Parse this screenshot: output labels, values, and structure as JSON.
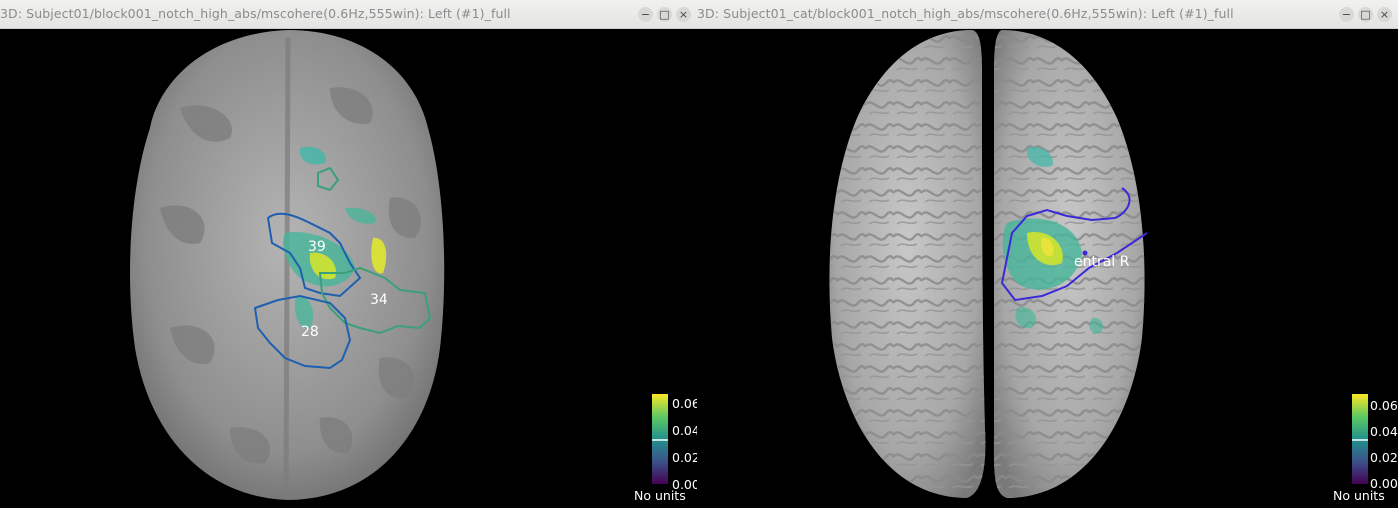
{
  "left_window": {
    "title": "3D: Subject01/block001_notch_high_abs/mscohere(0.6Hz,555win): Left (#1)_full",
    "buttons": [
      "−",
      "□",
      "×"
    ],
    "roi_labels": [
      "39",
      "34",
      "28"
    ],
    "colorbar": {
      "ticks": [
        "0.06",
        "0.04",
        "0.02",
        "0.00"
      ],
      "units": "No units"
    }
  },
  "right_window": {
    "title": "3D: Subject01_cat/block001_notch_high_abs/mscohere(0.6Hz,555win): Left (#1)_full",
    "buttons": [
      "−",
      "□",
      "×"
    ],
    "roi_label": "entral R",
    "colorbar": {
      "ticks": [
        "0.06",
        "0.04",
        "0.02",
        "0.00"
      ],
      "units": "No units"
    }
  },
  "colors": {
    "roi_blue": "#1f5fb0",
    "roi_green": "#3aa07a",
    "roi_purple": "#3a2ad8",
    "cortex": "#9a9a9a"
  }
}
